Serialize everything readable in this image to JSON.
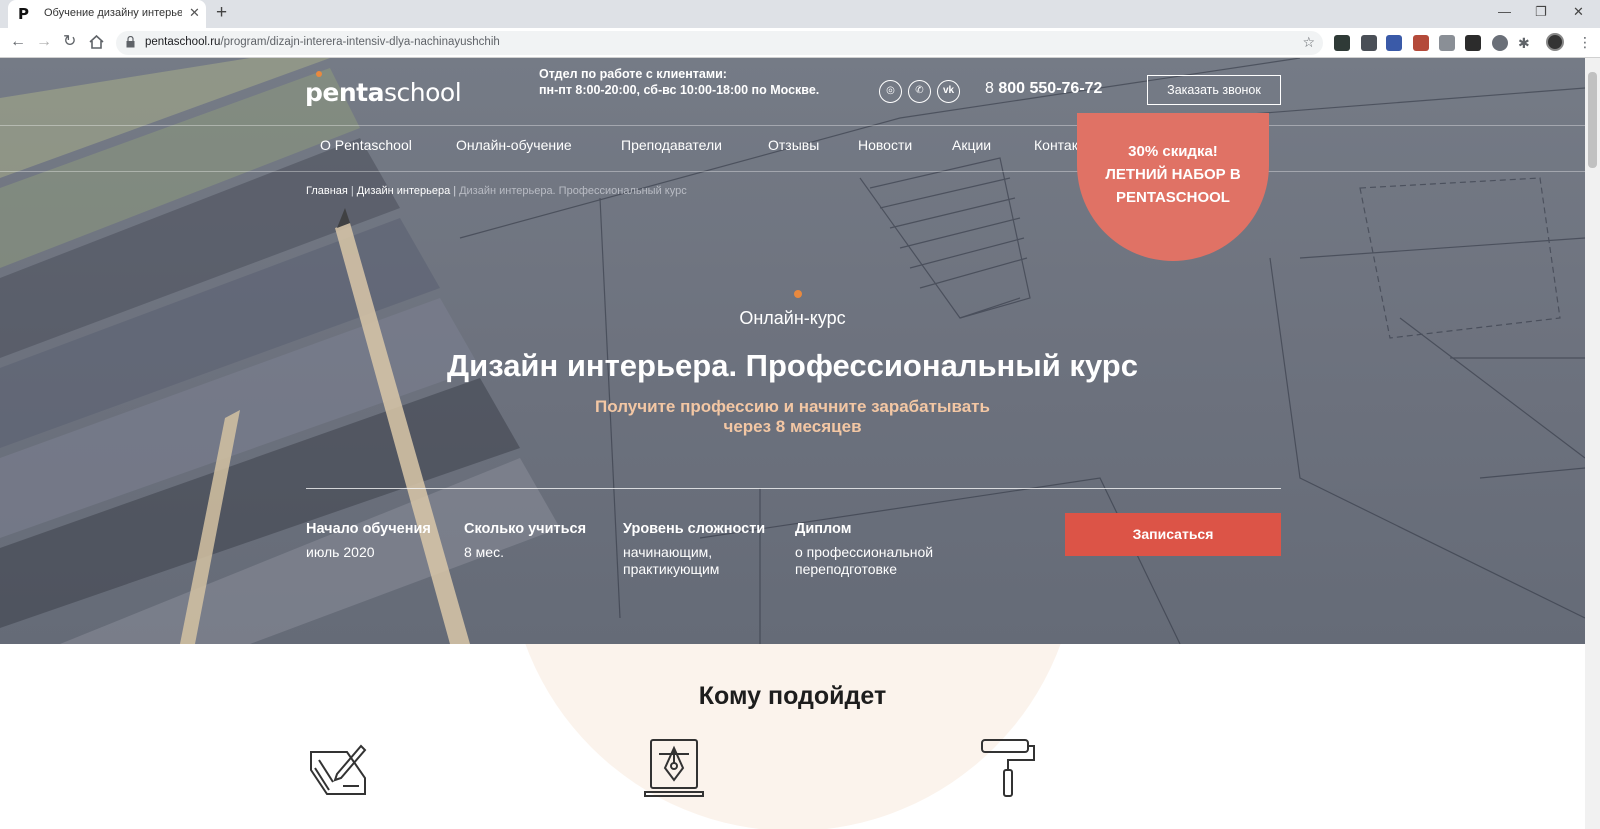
{
  "browser": {
    "tab_title": "Обучение дизайну интерьера, о",
    "tab_favicon": "P",
    "url_host": "pentaschool.ru",
    "url_path": "/program/dizajn-interera-intensiv-dlya-nachinayushchih"
  },
  "header": {
    "logo_part1": "penta",
    "logo_part2": "school",
    "client_dept_title": "Отдел по работе с клиентами:",
    "client_dept_hours": "пн-пт 8:00-20:00, сб-вс 10:00-18:00 по Москве.",
    "social_icons": [
      "instagram-icon",
      "whatsapp-icon",
      "vk-icon"
    ],
    "phone_prefix": "8",
    "phone_number": "800 550-76-72",
    "callback_label": "Заказать звонок"
  },
  "nav": {
    "items": [
      {
        "label": "О Pentaschool"
      },
      {
        "label": "Онлайн-обучение"
      },
      {
        "label": "Преподаватели"
      },
      {
        "label": "Отзывы"
      },
      {
        "label": "Новости"
      },
      {
        "label": "Акции"
      },
      {
        "label": "Контакты"
      }
    ]
  },
  "promo": {
    "line1": "30% скидка!",
    "line2": "ЛЕТНИЙ НАБОР В",
    "line3": "PENTASCHOOL"
  },
  "breadcrumb": {
    "home": "Главная",
    "section": "Дизайн интерьера",
    "current": "Дизайн интерьера. Профессиональный курс"
  },
  "hero": {
    "course_type": "Онлайн-курс",
    "title": "Дизайн интерьера. Профессиональный курс",
    "subtitle_line1": "Получите профессию и начните зарабатывать",
    "subtitle_line2": "через 8 месяцев",
    "stats": [
      {
        "label": "Начало обучения",
        "value": "июль 2020"
      },
      {
        "label": "Сколько учиться",
        "value": "8 мес."
      },
      {
        "label": "Уровень сложности",
        "value_line1": "начинающим,",
        "value_line2": "практикующим"
      },
      {
        "label": "Диплом",
        "value_line1": "о профессиональной",
        "value_line2": "переподготовке"
      }
    ],
    "signup_label": "Записаться"
  },
  "audience": {
    "title": "Кому подойдет",
    "icons": [
      "drawing-tablet-icon",
      "laptop-pen-tool-icon",
      "paint-roller-icon"
    ]
  },
  "colors": {
    "accent_orange": "#e8893f",
    "promo_red": "#e07265",
    "signup_red": "#dc5447",
    "subtitle_peach": "#f3c7a4",
    "beige": "#fbf3ec"
  }
}
